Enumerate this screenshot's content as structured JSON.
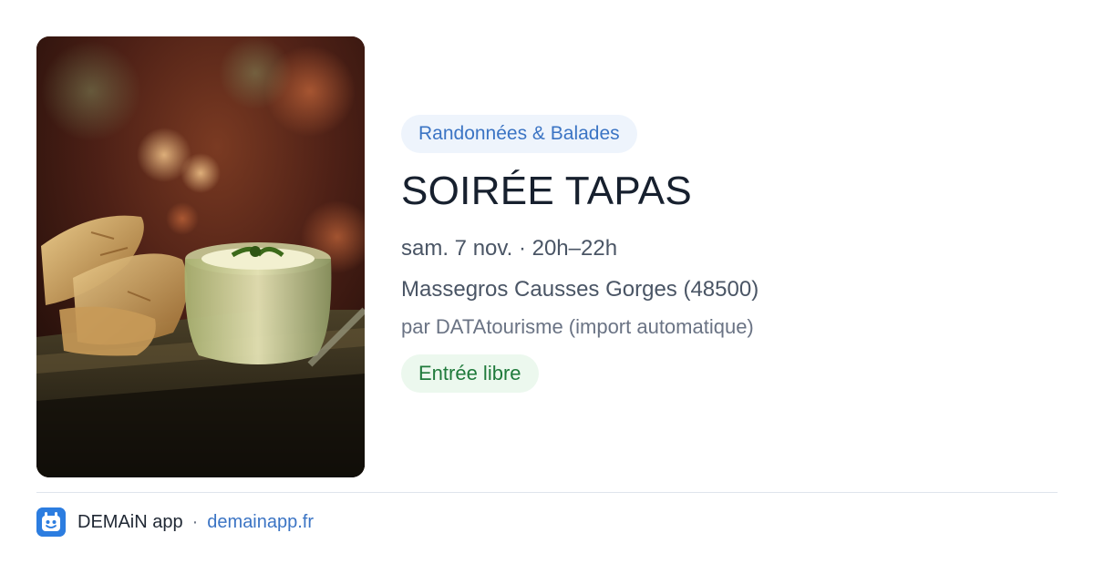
{
  "event": {
    "image_alt": "tapas-photo",
    "category": "Randonnées & Balades",
    "title": "SOIRÉE TAPAS",
    "datetime": "sam. 7 nov. · 20h–22h",
    "location": "Massegros Causses Gorges (48500)",
    "source": "par DATAtourisme (import automatique)",
    "price": "Entrée libre"
  },
  "footer": {
    "app_name": "DEMAiN app",
    "separator": "·",
    "url": "demainapp.fr"
  },
  "colors": {
    "accent_blue": "#3b74c4",
    "category_bg": "#eef4fc",
    "price_green": "#1f7a3b",
    "price_bg": "#ecf8ee",
    "title": "#17202e",
    "logo_bg": "#2c7de0"
  }
}
